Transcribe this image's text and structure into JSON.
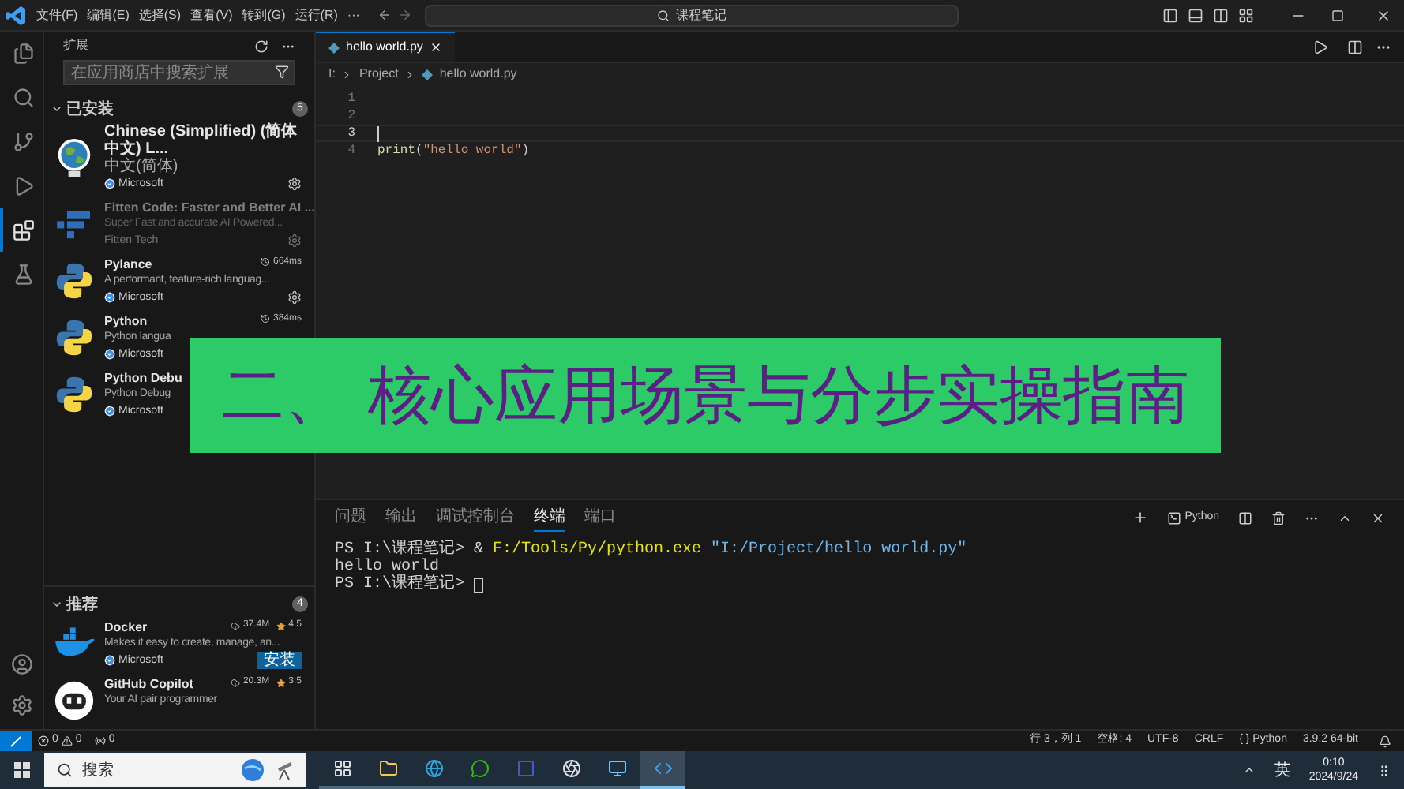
{
  "title_bar": {
    "menus": [
      "文件(F)",
      "编辑(E)",
      "选择(S)",
      "查看(V)",
      "转到(G)",
      "运行(R)",
      "···"
    ],
    "search": "课程笔记"
  },
  "activity_bar": {
    "items": [
      {
        "selected": false
      },
      {
        "selected": false
      },
      {
        "selected": false
      },
      {
        "selected": false
      },
      {
        "selected": true
      },
      {
        "selected": false
      }
    ]
  },
  "sidebar": {
    "title": "扩展",
    "search": {
      "placeholder": "在应用商店中搜索扩展"
    },
    "sections": [
      {
        "title": "已安装",
        "count": "5",
        "items": [
          {
            "kind": "globe",
            "name": "Chinese (Simplified) (简体中文) L...",
            "description": "中文(简体)",
            "publisher": "Microsoft",
            "verified": true,
            "disabled": false,
            "settings": true
          },
          {
            "kind": "fitten",
            "name": "Fitten Code: Faster and Better AI ...",
            "description": "Super Fast and accurate AI Powered...",
            "publisher": "Fitten Tech",
            "verified": false,
            "disabled": true,
            "settings": true
          },
          {
            "kind": "python",
            "name": "Pylance",
            "description": "A performant, feature-rich languag...",
            "publisher": "Microsoft",
            "verified": true,
            "disabled": false,
            "timing": "664ms",
            "settings": true
          },
          {
            "kind": "python",
            "name": "Python",
            "description": "Python langua",
            "publisher": "Microsoft",
            "verified": true,
            "disabled": false,
            "timing": "384ms",
            "settings": false
          },
          {
            "kind": "python",
            "name": "Python Debu",
            "description": "Python Debug",
            "publisher": "Microsoft",
            "verified": true,
            "disabled": false,
            "settings": false
          }
        ]
      },
      {
        "title": "推荐",
        "count": "4",
        "items": [
          {
            "kind": "docker",
            "name": "Docker",
            "description": "Makes it easy to create, manage, an...",
            "publisher": "Microsoft",
            "verified": true,
            "disabled": false,
            "downloads": "37.4M",
            "rating": "4.5",
            "install_label": "安装",
            "settings": false
          },
          {
            "kind": "copilot",
            "name": "GitHub Copilot",
            "description": "Your AI pair programmer",
            "disabled": false,
            "downloads": "20.3M",
            "rating": "3.5",
            "settings": false
          }
        ]
      }
    ]
  },
  "editor": {
    "tab": "hello world.py",
    "breadcrumbs": [
      {
        "text": "I:",
        "file": false
      },
      {
        "text": "Project",
        "file": false
      },
      {
        "text": "hello world.py",
        "file": true
      }
    ],
    "lines": [
      {
        "number": "1",
        "current": false
      },
      {
        "number": "2",
        "current": false
      },
      {
        "number": "3",
        "current": true
      },
      {
        "number": "4",
        "current": false,
        "tokens": [
          {
            "kind": "function",
            "text": "print"
          },
          {
            "kind": "plain",
            "text": "("
          },
          {
            "kind": "string",
            "text": "\"hello world\""
          },
          {
            "kind": "plain",
            "text": ")"
          }
        ]
      }
    ]
  },
  "panel": {
    "tabs": [
      {
        "label": "问题",
        "selected": false
      },
      {
        "label": "输出",
        "selected": false
      },
      {
        "label": "调试控制台",
        "selected": false
      },
      {
        "label": "终端",
        "selected": true
      },
      {
        "label": "端口",
        "selected": false
      }
    ],
    "shell": "Python",
    "terminal": [
      {
        "cursor": false,
        "segments": [
          {
            "kind": "plain",
            "text": "PS I:\\课程笔记> & "
          },
          {
            "kind": "command",
            "text": "F:/Tools/Py/python.exe"
          },
          {
            "kind": "string",
            "text": " \"I:/Project/hello world.py\""
          }
        ]
      },
      {
        "cursor": false,
        "segments": [
          {
            "kind": "plain",
            "text": "hello world"
          }
        ]
      },
      {
        "cursor": true,
        "segments": [
          {
            "kind": "plain",
            "text": "PS I:\\课程笔记> "
          }
        ]
      }
    ]
  },
  "status_bar": {
    "errors": "0",
    "warnings": "0",
    "ports": "0",
    "right": [
      "行 3，列 1",
      "空格: 4",
      "UTF-8",
      "CRLF",
      "{ } Python",
      "3.9.2 64-bit"
    ]
  },
  "banner": {
    "text": "二、 核心应用场景与分步实操指南"
  },
  "taskbar": {
    "search": "搜索",
    "apps": [
      {
        "selected": false
      },
      {
        "selected": false
      },
      {
        "selected": false
      },
      {
        "selected": false
      },
      {
        "selected": false
      },
      {
        "selected": false
      },
      {
        "selected": false
      },
      {
        "selected": true
      }
    ],
    "ime": "英",
    "time": "0:10",
    "date": "2024/9/24"
  }
}
